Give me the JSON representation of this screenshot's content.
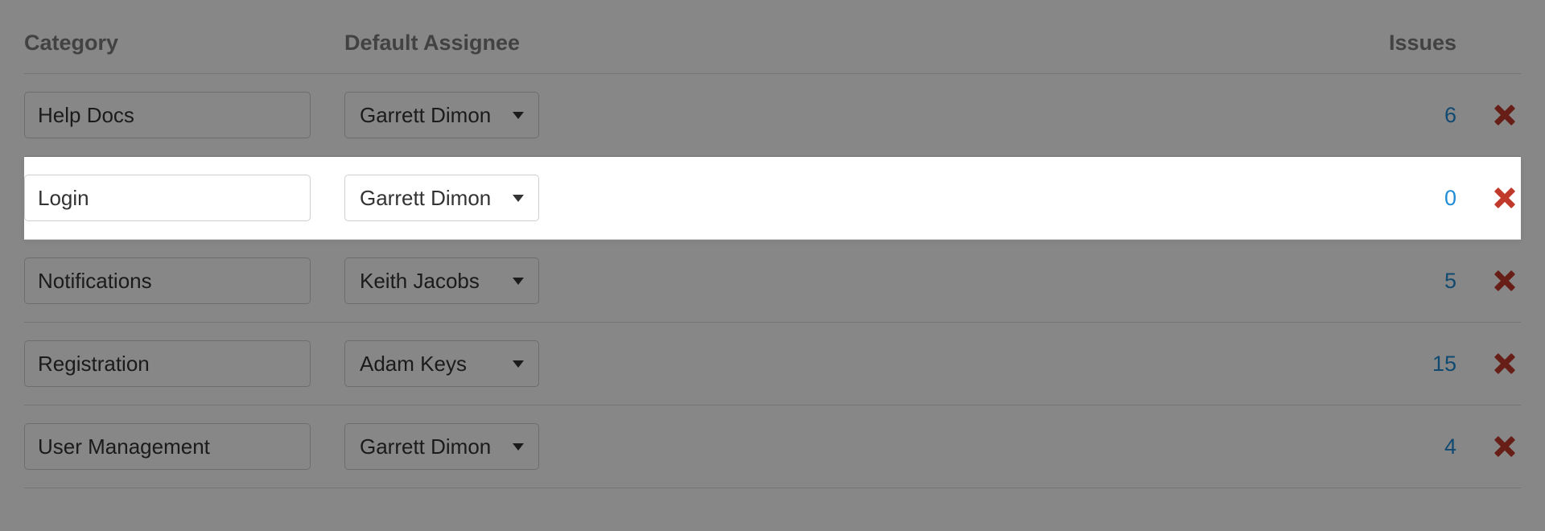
{
  "columns": {
    "category": "Category",
    "assignee": "Default Assignee",
    "issues": "Issues"
  },
  "rows": [
    {
      "category": "Help Docs",
      "assignee": "Garrett Dimon",
      "issues": "6",
      "highlight": false
    },
    {
      "category": "Login",
      "assignee": "Garrett Dimon",
      "issues": "0",
      "highlight": true
    },
    {
      "category": "Notifications",
      "assignee": "Keith Jacobs",
      "issues": "5",
      "highlight": false
    },
    {
      "category": "Registration",
      "assignee": "Adam Keys",
      "issues": "15",
      "highlight": false
    },
    {
      "category": "User Management",
      "assignee": "Garrett Dimon",
      "issues": "4",
      "highlight": false
    }
  ]
}
